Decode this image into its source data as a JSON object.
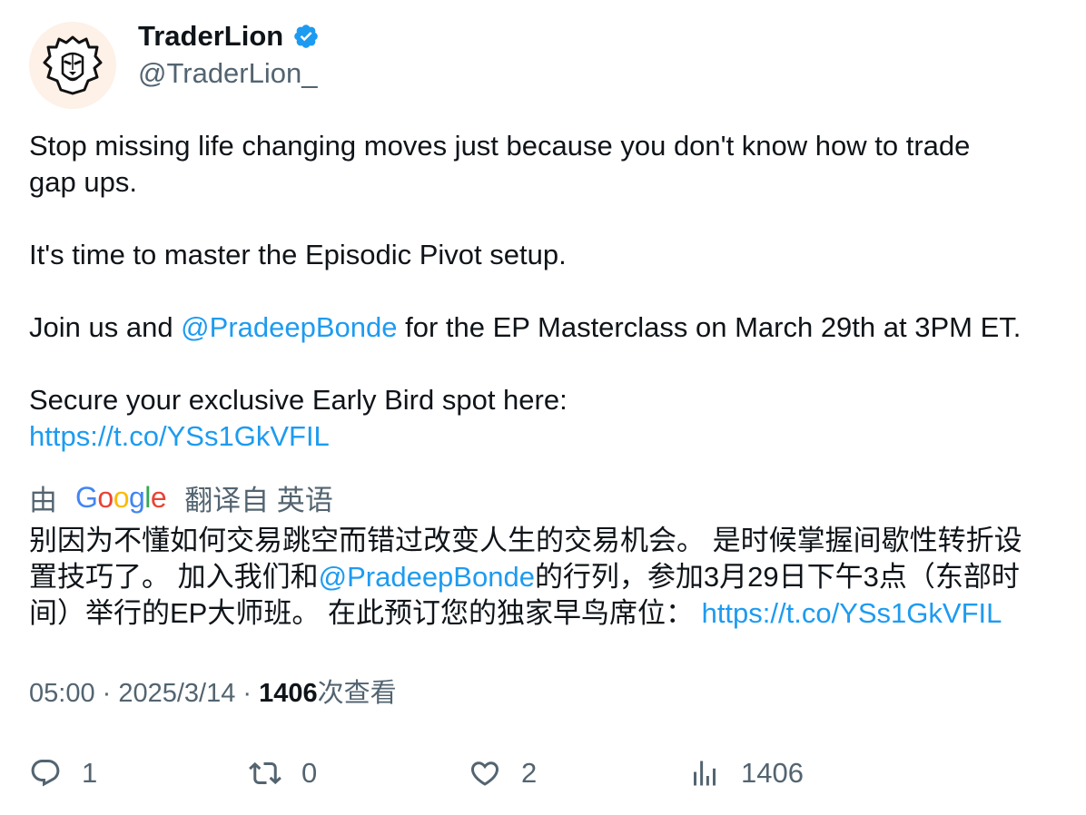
{
  "author": {
    "display_name": "TraderLion",
    "handle": "@TraderLion_",
    "avatar_icon": "lion-head-icon",
    "verified_icon": "verified-badge-icon",
    "verified_color": "#1d9bf0"
  },
  "tweet": {
    "line1": "Stop missing life changing moves just because you don't know how to trade",
    "line2": "gap ups.",
    "line3": "It's time to master the Episodic Pivot setup.",
    "line4_prefix": "Join us and ",
    "mention": "@PradeepBonde",
    "line4_suffix": " for the EP Masterclass on March 29th at 3PM ET.",
    "line5": "Secure your exclusive Early Bird spot here:",
    "link": "https://t.co/YSs1GkVFIL"
  },
  "translation": {
    "prefix": "由",
    "suffix": "翻译自 英语",
    "google_logo": [
      "G",
      "o",
      "o",
      "g",
      "l",
      "e"
    ],
    "line1": "别因为不懂如何交易跳空而错过改变人生的交易机会。 是时候掌握间歇性转折设",
    "line2_prefix": "置技巧了。 加入我们和",
    "mention": "@PradeepBonde",
    "line2_suffix": "的行列，参加3月29日下午3点（东部时",
    "line3_prefix": "间）举行的EP大师班。 在此预订您的独家早鸟席位： ",
    "link": "https://t.co/YSs1GkVFIL"
  },
  "meta": {
    "time": "05:00",
    "sep1": " · ",
    "date": "2025/3/14",
    "sep2": " · ",
    "views_count": "1406",
    "views_label": "次查看"
  },
  "actions": {
    "reply_count": "1",
    "retweet_count": "0",
    "like_count": "2",
    "views_count": "1406"
  },
  "colors": {
    "link": "#1d9bf0",
    "text": "#0f1419",
    "secondary": "#536471"
  }
}
